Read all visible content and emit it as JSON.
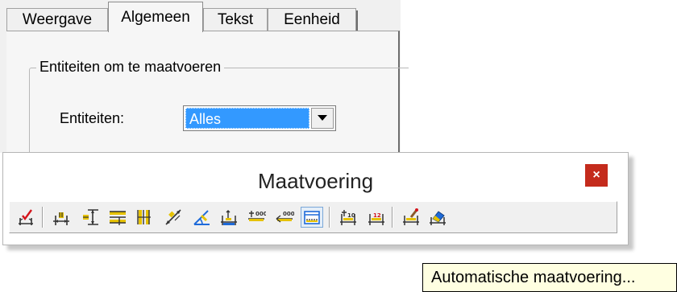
{
  "dialog": {
    "tabs": [
      {
        "label": "Weergave",
        "active": false
      },
      {
        "label": "Algemeen",
        "active": true
      },
      {
        "label": "Tekst",
        "active": false
      },
      {
        "label": "Eenheid",
        "active": false
      }
    ],
    "group_title": "Entiteiten om te maatvoeren",
    "entities_label": "Entiteiten:",
    "entities_value": "Alles"
  },
  "toolbar": {
    "title": "Maatvoering",
    "close_label": "×",
    "close_color": "#c42b1c",
    "buttons": [
      {
        "icon": "smart-dimension-icon"
      },
      {
        "icon": "horizontal-dimension-icon"
      },
      {
        "icon": "vertical-dimension-icon"
      },
      {
        "icon": "baseline-dimension-icon"
      },
      {
        "icon": "ordinate-dimension-icon"
      },
      {
        "icon": "aligned-dimension-icon"
      },
      {
        "icon": "angular-dimension-icon"
      },
      {
        "icon": "chain-dimension-icon"
      },
      {
        "icon": "horizontal-ordinate-icon"
      },
      {
        "icon": "vertical-ordinate-icon"
      },
      {
        "icon": "auto-dimension-icon",
        "pressed": true
      },
      {
        "icon": "edit-dimension-text-icon"
      },
      {
        "icon": "dimension-style-icon"
      },
      {
        "icon": "dimension-properties-icon"
      },
      {
        "icon": "erase-dimension-icon"
      }
    ]
  },
  "tooltip": {
    "text": "Automatische maatvoering..."
  }
}
